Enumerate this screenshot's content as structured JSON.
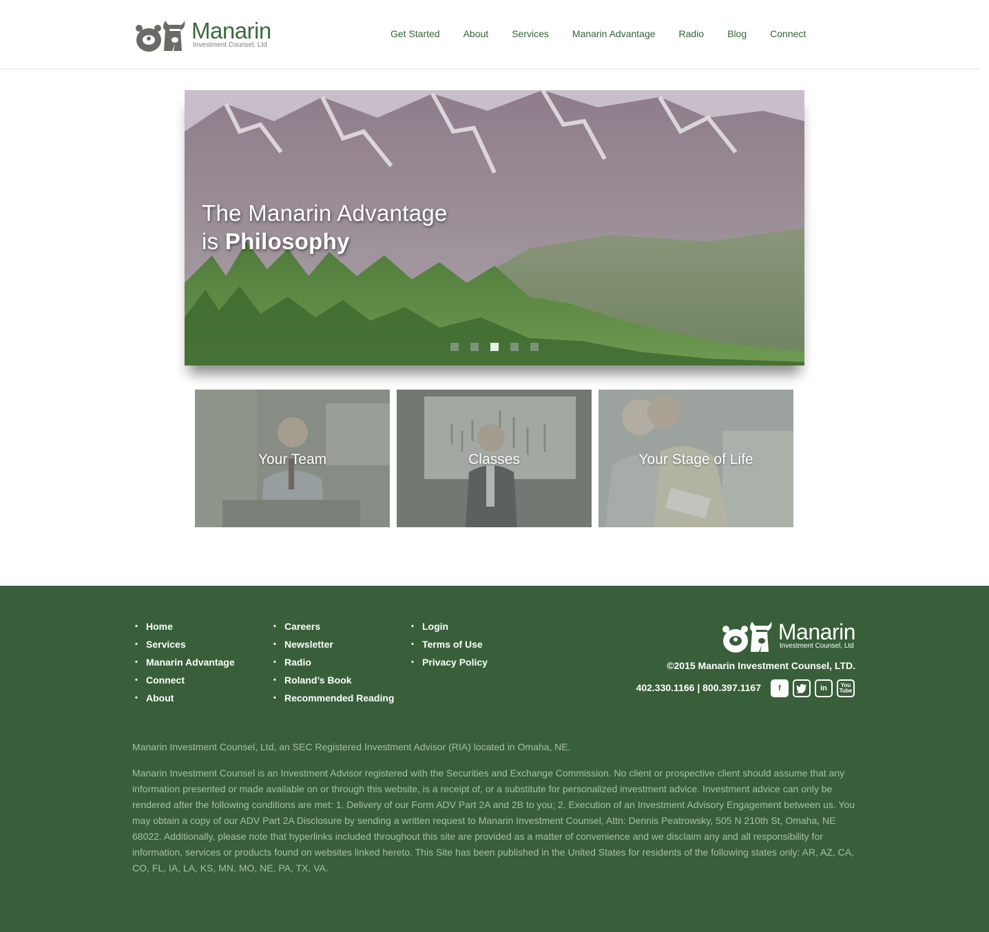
{
  "brand": {
    "name": "Manarin",
    "subtitle": "Investment Counsel, Ltd"
  },
  "nav": {
    "items": [
      "Get Started",
      "About",
      "Services",
      "Manarin Advantage",
      "Radio",
      "Blog",
      "Connect"
    ]
  },
  "hero": {
    "line1": "The Manarin Advantage",
    "line2_prefix": "is",
    "line2_bold": "Philosophy",
    "slides_count": 5,
    "active_slide": 3
  },
  "tiles": [
    {
      "label": "Your Team"
    },
    {
      "label": "Classes"
    },
    {
      "label": "Your Stage of Life"
    }
  ],
  "footer": {
    "col1": [
      "Home",
      "Services",
      "Manarin Advantage",
      "Connect",
      "About"
    ],
    "col2": [
      "Careers",
      "Newsletter",
      "Radio",
      "Roland’s Book",
      "Recommended Reading"
    ],
    "col3": [
      "Login",
      "Terms of Use",
      "Privacy Policy"
    ],
    "copyright": "©2015 Manarin Investment Counsel, LTD.",
    "phones": "402.330.1166 | 800.397.1167",
    "socials": [
      "facebook-icon",
      "twitter-icon",
      "linkedin-icon",
      "youtube-icon"
    ],
    "disclaimer1": "Manarin Investment Counsel, Ltd, an SEC Registered Investment Advisor (RIA) located in Omaha, NE.",
    "disclaimer2": "Manarin Investment Counsel is an Investment Advisor registered with the Securities and Exchange Commission. No client or prospective client should assume that any information presented or made available on or through this website, is a receipt of, or a substitute for personalized investment advice. Investment advice can only be rendered after the following conditions are met: 1. Delivery of our Form ADV Part 2A and 2B to you; 2. Execution of an Investment Advisory Engagement between us. You may obtain a copy of our ADV Part 2A Disclosure by sending a written request to Manarin Investment Counsel, Attn: Dennis Peatrowsky, 505 N 210th St, Omaha, NE 68022. Additionally, please note that hyperlinks included throughout this site are provided as a matter of convenience and we disclaim any and all responsibility for information, services or products found on websites linked hereto. This Site has been published in the United States for residents of the following states only: AR, AZ, CA, CO, FL, IA, LA, KS, MN, MO, NE, PA, TX, VA."
  },
  "colors": {
    "brand_green": "#385f39",
    "nav_green": "#34613a"
  }
}
